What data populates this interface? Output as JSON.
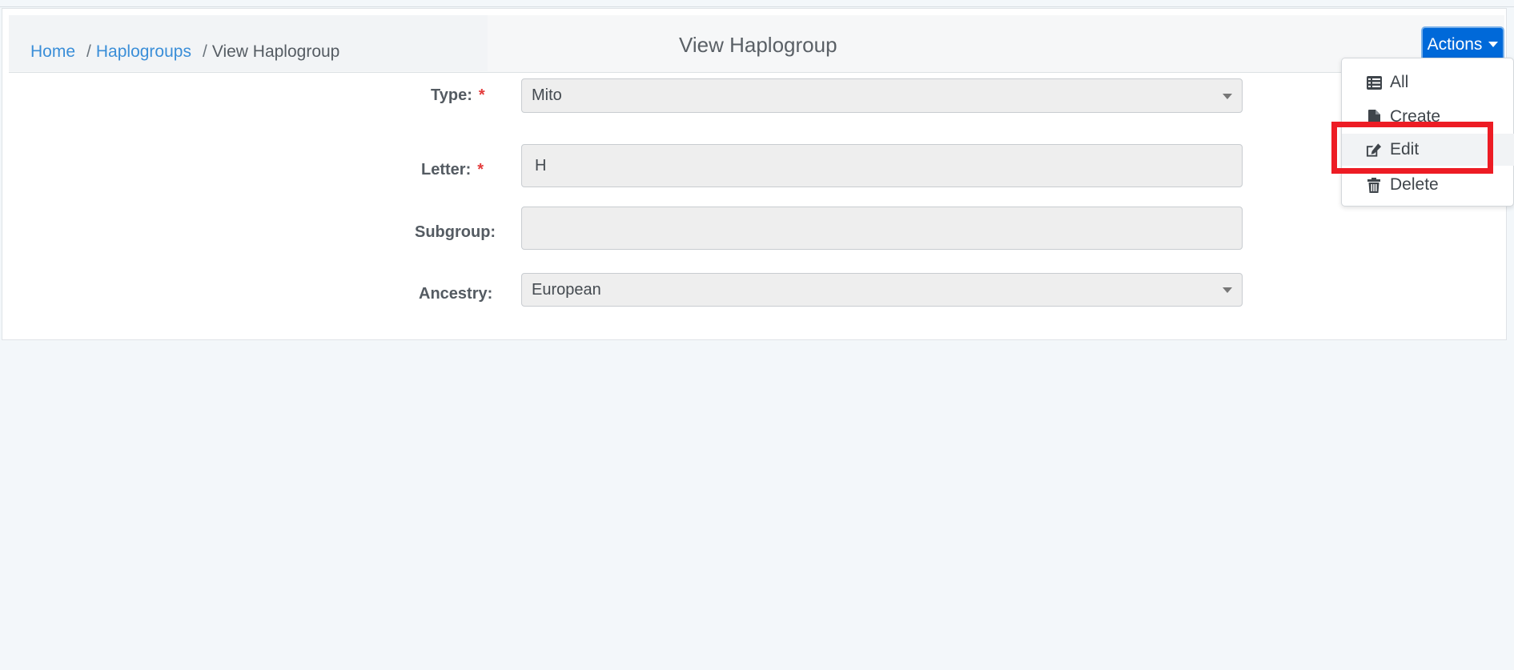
{
  "breadcrumb": {
    "home": "Home",
    "haplogroups": "Haplogroups",
    "current": "View Haplogroup",
    "separator": "/"
  },
  "header": {
    "title": "View Haplogroup",
    "actions_label": "Actions"
  },
  "form": {
    "type": {
      "label": "Type:",
      "required_mark": "*",
      "value": "Mito"
    },
    "letter": {
      "label": "Letter:",
      "required_mark": "*",
      "value": "H"
    },
    "subgroup": {
      "label": "Subgroup:",
      "value": ""
    },
    "ancestry": {
      "label": "Ancestry:",
      "value": "European"
    }
  },
  "actions_menu": {
    "items": [
      {
        "label": "All",
        "icon": "list-icon"
      },
      {
        "label": "Create",
        "icon": "file-icon"
      },
      {
        "label": "Edit",
        "icon": "edit-icon",
        "highlighted": true
      },
      {
        "label": "Delete",
        "icon": "trash-icon"
      }
    ]
  },
  "colors": {
    "accent": "#0069d9",
    "link": "#3a8ed8",
    "required": "#e33b3b",
    "highlight": "#ed1c24"
  }
}
